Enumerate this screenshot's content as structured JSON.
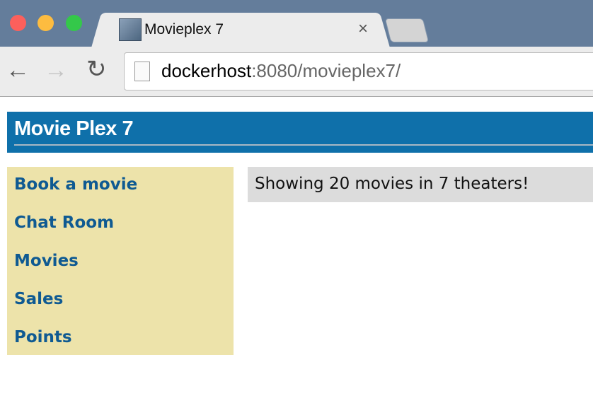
{
  "browser": {
    "tab_title": "Movieplex 7",
    "tab_close": "×",
    "url_host": "dockerhost",
    "url_rest": ":8080/movieplex7/",
    "icons": {
      "back": "arrow-left-icon",
      "forward": "arrow-right-icon",
      "reload": "reload-icon",
      "page": "page-icon"
    }
  },
  "header": {
    "title": "Movie Plex 7",
    "color": "#0f70aa"
  },
  "sidebar": {
    "items": [
      {
        "label": "Book a movie"
      },
      {
        "label": "Chat Room"
      },
      {
        "label": "Movies"
      },
      {
        "label": "Sales"
      },
      {
        "label": "Points"
      }
    ]
  },
  "main": {
    "message": "Showing 20 movies in 7 theaters!"
  }
}
